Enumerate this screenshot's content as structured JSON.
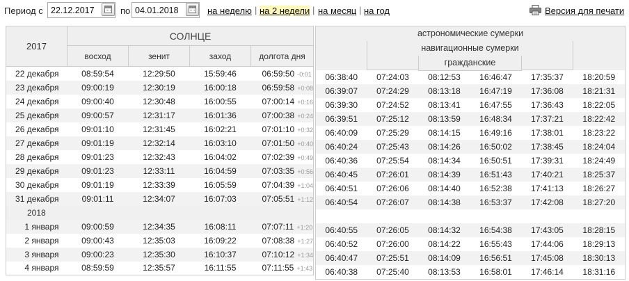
{
  "period": {
    "label": "Период с",
    "from": "22.12.2017",
    "to_label": "по",
    "to": "04.01.2018"
  },
  "quick_links": [
    "на неделю",
    "на 2 недели",
    "на месяц",
    "на год"
  ],
  "print_link": "Версия для печати",
  "icons": [
    "calendar-icon",
    "printer-icon"
  ],
  "sun": {
    "year_header": "2017",
    "title": "СОЛНЦЕ",
    "columns": [
      "восход",
      "зенит",
      "заход",
      "долгота дня"
    ]
  },
  "twilight": {
    "astronomical": "астрономические сумерки",
    "nautical": "навигационные сумерки",
    "civil": "гражданские"
  },
  "rows": [
    {
      "date": "22 декабря",
      "sunrise": "08:59:54",
      "zenith": "12:29:50",
      "sunset": "15:59:46",
      "day_length": "06:59:50",
      "delta": "-0:01",
      "tw": [
        "06:38:40",
        "07:24:03",
        "08:12:53",
        "16:46:47",
        "17:35:37",
        "18:20:59"
      ]
    },
    {
      "date": "23 декабря",
      "sunrise": "09:00:19",
      "zenith": "12:30:19",
      "sunset": "16:00:18",
      "day_length": "06:59:58",
      "delta": "+0:08",
      "tw": [
        "06:39:07",
        "07:24:29",
        "08:13:18",
        "16:47:19",
        "17:36:08",
        "18:21:31"
      ]
    },
    {
      "date": "24 декабря",
      "sunrise": "09:00:40",
      "zenith": "12:30:48",
      "sunset": "16:00:55",
      "day_length": "07:00:14",
      "delta": "+0:16",
      "tw": [
        "06:39:30",
        "07:24:52",
        "08:13:41",
        "16:47:55",
        "17:36:43",
        "18:22:05"
      ]
    },
    {
      "date": "25 декабря",
      "sunrise": "09:00:57",
      "zenith": "12:31:17",
      "sunset": "16:01:36",
      "day_length": "07:00:38",
      "delta": "+0:24",
      "tw": [
        "06:39:51",
        "07:25:12",
        "08:13:59",
        "16:48:34",
        "17:37:21",
        "18:22:42"
      ]
    },
    {
      "date": "26 декабря",
      "sunrise": "09:01:10",
      "zenith": "12:31:45",
      "sunset": "16:02:21",
      "day_length": "07:01:10",
      "delta": "+0:32",
      "tw": [
        "06:40:09",
        "07:25:29",
        "08:14:15",
        "16:49:16",
        "17:38:01",
        "18:23:22"
      ]
    },
    {
      "date": "27 декабря",
      "sunrise": "09:01:19",
      "zenith": "12:32:14",
      "sunset": "16:03:10",
      "day_length": "07:01:50",
      "delta": "+0:40",
      "tw": [
        "06:40:24",
        "07:25:43",
        "08:14:26",
        "16:50:02",
        "17:38:45",
        "18:24:04"
      ]
    },
    {
      "date": "28 декабря",
      "sunrise": "09:01:23",
      "zenith": "12:32:43",
      "sunset": "16:04:02",
      "day_length": "07:02:39",
      "delta": "+0:49",
      "tw": [
        "06:40:36",
        "07:25:54",
        "08:14:34",
        "16:50:51",
        "17:39:31",
        "18:24:49"
      ]
    },
    {
      "date": "29 декабря",
      "sunrise": "09:01:23",
      "zenith": "12:33:11",
      "sunset": "16:04:59",
      "day_length": "07:03:35",
      "delta": "+0:56",
      "tw": [
        "06:40:45",
        "07:26:01",
        "08:14:39",
        "16:51:43",
        "17:40:21",
        "18:25:37"
      ]
    },
    {
      "date": "30 декабря",
      "sunrise": "09:01:19",
      "zenith": "12:33:39",
      "sunset": "16:05:59",
      "day_length": "07:04:39",
      "delta": "+1:04",
      "tw": [
        "06:40:51",
        "07:26:06",
        "08:14:40",
        "16:52:38",
        "17:41:13",
        "18:26:27"
      ]
    },
    {
      "date": "31 декабря",
      "sunrise": "09:01:11",
      "zenith": "12:34:07",
      "sunset": "16:07:03",
      "day_length": "07:05:51",
      "delta": "+1:12",
      "tw": [
        "06:40:54",
        "07:26:07",
        "08:14:38",
        "16:53:37",
        "17:42:08",
        "18:27:20"
      ]
    },
    {
      "year": "2018"
    },
    {
      "date": "1 января",
      "sunrise": "09:00:59",
      "zenith": "12:34:35",
      "sunset": "16:08:11",
      "day_length": "07:07:11",
      "delta": "+1:20",
      "tw": [
        "06:40:55",
        "07:26:05",
        "08:14:32",
        "16:54:38",
        "17:43:05",
        "18:28:15"
      ]
    },
    {
      "date": "2 января",
      "sunrise": "09:00:43",
      "zenith": "12:35:03",
      "sunset": "16:09:22",
      "day_length": "07:08:38",
      "delta": "+1:27",
      "tw": [
        "06:40:52",
        "07:26:00",
        "08:14:22",
        "16:55:43",
        "17:44:06",
        "18:29:13"
      ]
    },
    {
      "date": "3 января",
      "sunrise": "09:00:23",
      "zenith": "12:35:30",
      "sunset": "16:10:37",
      "day_length": "07:10:12",
      "delta": "+1:34",
      "tw": [
        "06:40:47",
        "07:25:51",
        "08:14:09",
        "16:56:51",
        "17:45:08",
        "18:30:13"
      ]
    },
    {
      "date": "4 января",
      "sunrise": "08:59:59",
      "zenith": "12:35:57",
      "sunset": "16:11:55",
      "day_length": "07:11:55",
      "delta": "+1:43",
      "tw": [
        "06:40:38",
        "07:25:40",
        "08:13:53",
        "16:58:01",
        "17:46:14",
        "18:31:16"
      ]
    }
  ]
}
